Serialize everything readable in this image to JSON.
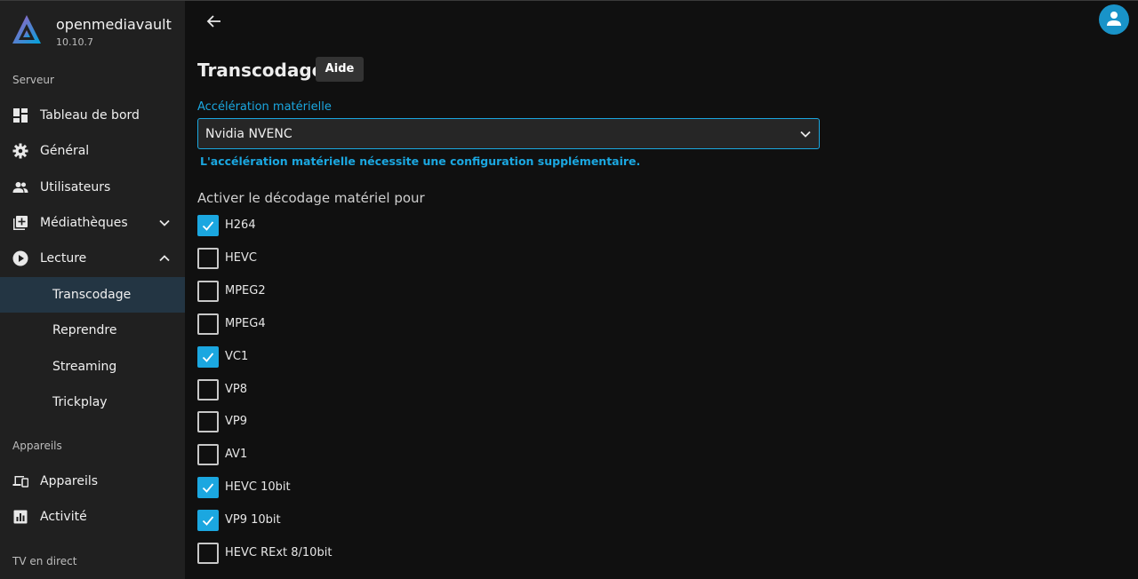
{
  "brand": {
    "name": "openmediavault",
    "version": "10.10.7"
  },
  "sidebar": {
    "sections": [
      {
        "label": "Serveur"
      },
      {
        "label": "Appareils"
      },
      {
        "label": "TV en direct"
      }
    ],
    "items": [
      {
        "label": "Tableau de bord",
        "icon": "dashboard-icon"
      },
      {
        "label": "Général",
        "icon": "gear-icon"
      },
      {
        "label": "Utilisateurs",
        "icon": "users-icon"
      },
      {
        "label": "Médiathèques",
        "icon": "library-add-icon"
      },
      {
        "label": "Lecture",
        "icon": "play-circle-icon"
      },
      {
        "label": "Transcodage",
        "active": true
      },
      {
        "label": "Reprendre"
      },
      {
        "label": "Streaming"
      },
      {
        "label": "Trickplay"
      },
      {
        "label": "Appareils",
        "icon": "devices-icon"
      },
      {
        "label": "Activité",
        "icon": "activity-chart-icon"
      }
    ]
  },
  "header": {
    "back_icon": "arrow-left-icon",
    "avatar_icon": "user-icon"
  },
  "main": {
    "title": "Transcodage",
    "help_label": "Aide",
    "hw_accel": {
      "label": "Accélération matérielle",
      "value": "Nvidia NVENC",
      "note": "L'accélération matérielle nécessite une configuration supplémentaire."
    },
    "decode_title": "Activer le décodage matériel pour",
    "codecs": [
      {
        "label": "H264",
        "checked": true
      },
      {
        "label": "HEVC",
        "checked": false
      },
      {
        "label": "MPEG2",
        "checked": false
      },
      {
        "label": "MPEG4",
        "checked": false
      },
      {
        "label": "VC1",
        "checked": true
      },
      {
        "label": "VP8",
        "checked": false
      },
      {
        "label": "VP9",
        "checked": false
      },
      {
        "label": "AV1",
        "checked": false
      },
      {
        "label": "HEVC 10bit",
        "checked": true
      },
      {
        "label": "VP9 10bit",
        "checked": true
      },
      {
        "label": "HEVC RExt 8/10bit",
        "checked": false
      }
    ]
  },
  "colors": {
    "accent": "#1ba7e0",
    "sidebar_bg": "#202020",
    "page_bg": "#101010",
    "active_bg": "#233543"
  }
}
